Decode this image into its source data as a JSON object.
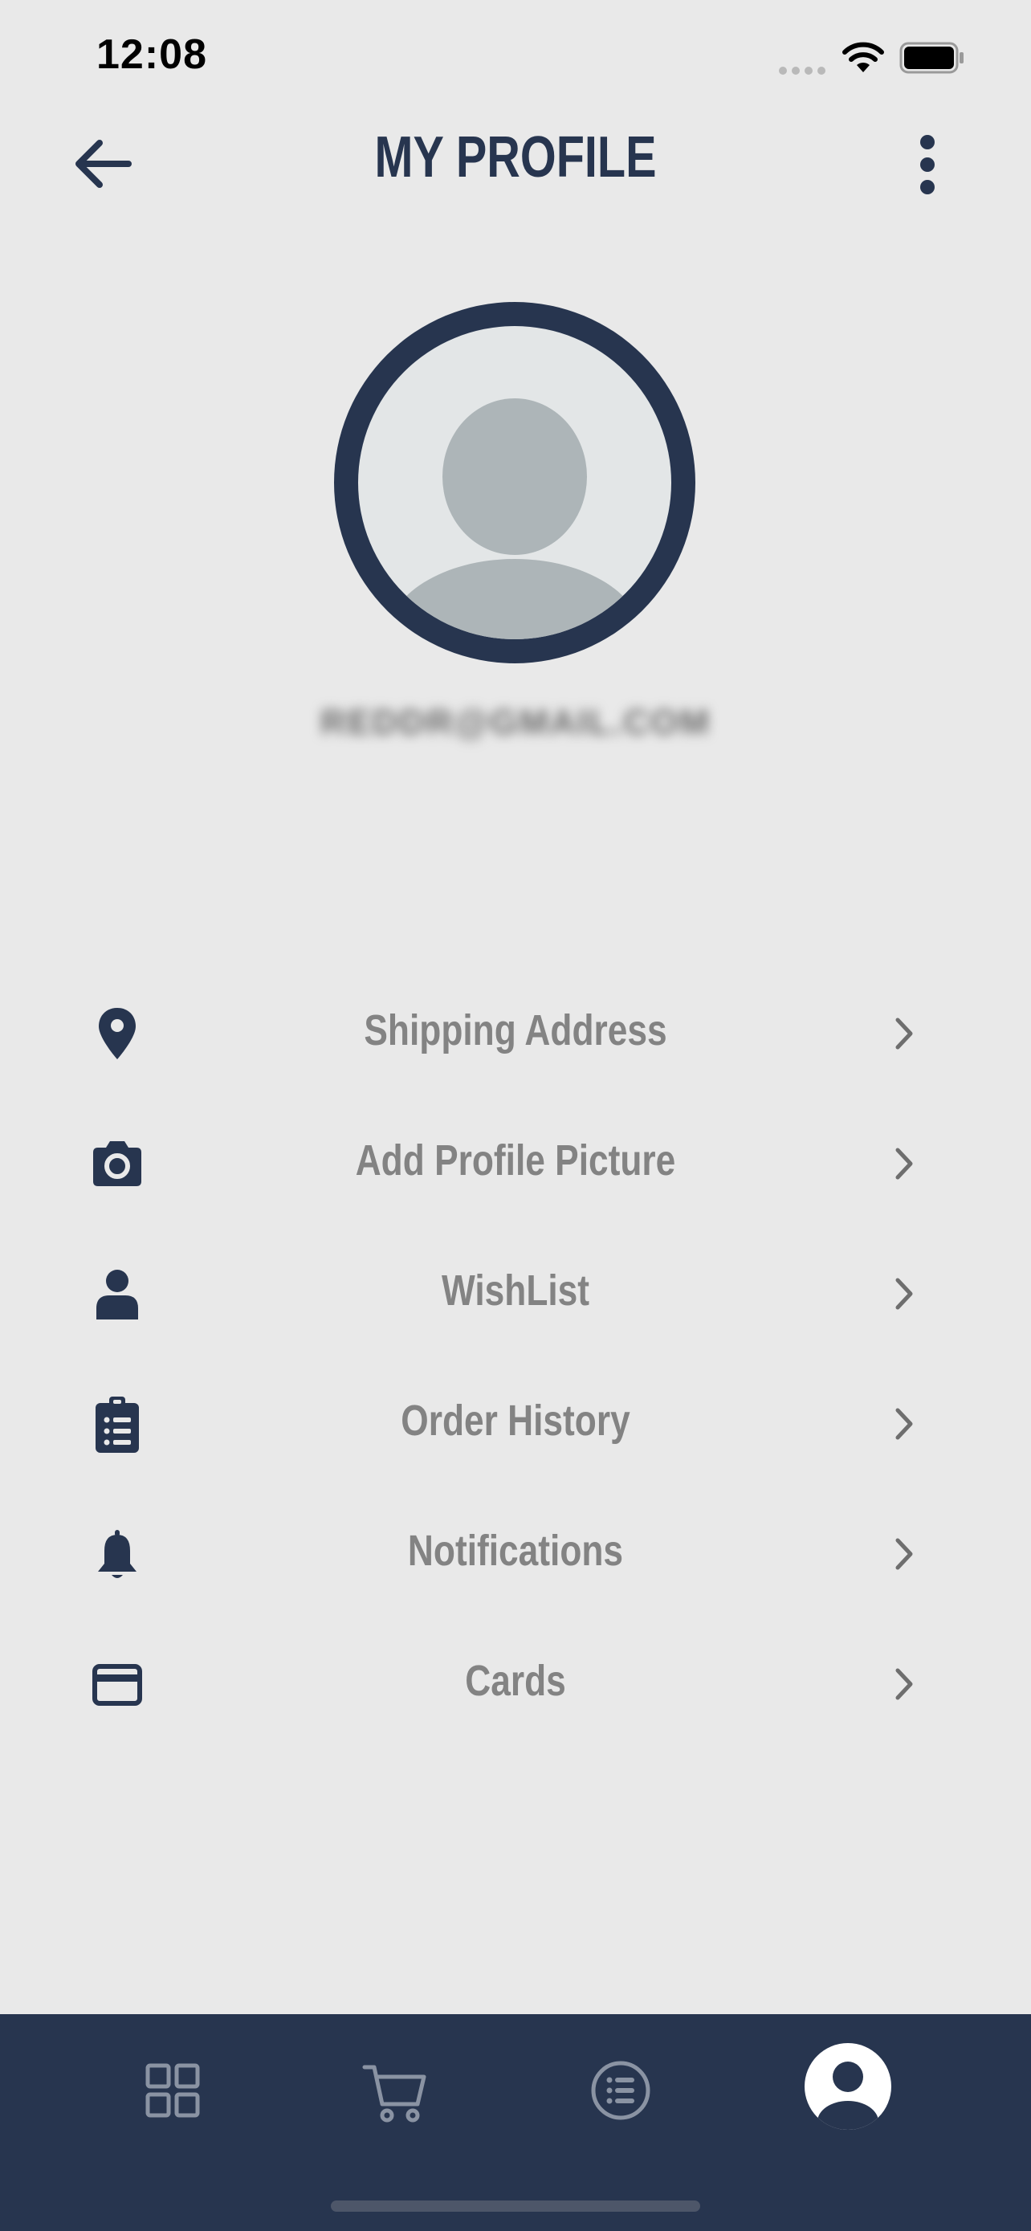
{
  "status_bar": {
    "time": "12:08"
  },
  "header": {
    "title": "MY PROFILE",
    "back_icon": "arrow-left-icon",
    "menu_icon": "more-vertical-icon"
  },
  "profile": {
    "avatar_icon": "user-avatar-placeholder",
    "email": "REDDR@GMAIL.COM"
  },
  "menu": {
    "items": [
      {
        "label": "Shipping Address",
        "icon": "map-pin-icon"
      },
      {
        "label": "Add Profile Picture",
        "icon": "camera-icon"
      },
      {
        "label": "WishList",
        "icon": "user-icon"
      },
      {
        "label": "Order History",
        "icon": "clipboard-list-icon"
      },
      {
        "label": "Notifications",
        "icon": "bell-icon"
      },
      {
        "label": "Cards",
        "icon": "credit-card-icon"
      }
    ]
  },
  "bottom_nav": {
    "items": [
      {
        "icon": "grid-icon",
        "active": false
      },
      {
        "icon": "cart-icon",
        "active": false
      },
      {
        "icon": "list-icon",
        "active": false
      },
      {
        "icon": "profile-icon",
        "active": true
      }
    ]
  },
  "colors": {
    "background": "#e9e9e9",
    "primary": "#27354f",
    "menu_text": "#838383",
    "avatar_placeholder": "#adb5b8"
  }
}
